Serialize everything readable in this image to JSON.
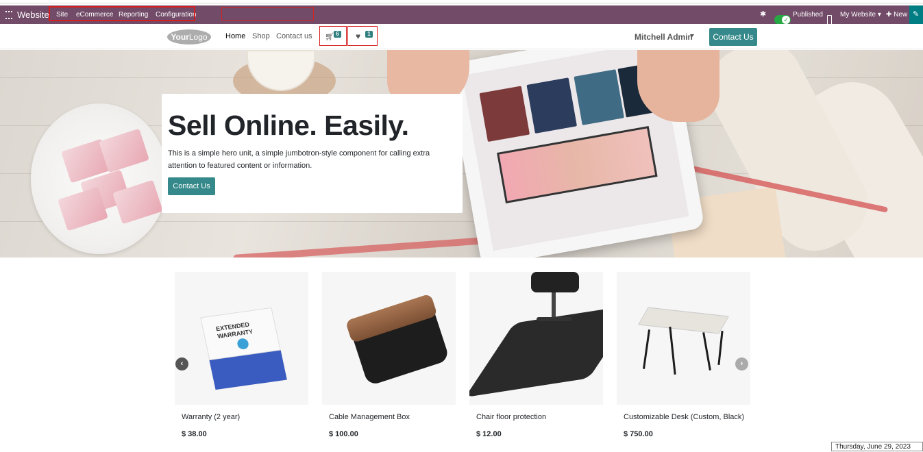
{
  "admin_bar": {
    "app_name": "Website",
    "menu": [
      "Site",
      "eCommerce",
      "Reporting",
      "Configuration"
    ],
    "published_label": "Published",
    "my_website_label": "My Website",
    "new_label": "New"
  },
  "site_header": {
    "logo": {
      "part1": "Your",
      "part2": "Logo"
    },
    "nav": [
      "Home",
      "Shop",
      "Contact us"
    ],
    "cart_count": "6",
    "wishlist_count": "1",
    "user_name": "Mitchell Admin",
    "contact_button": "Contact Us"
  },
  "hero": {
    "title": "Sell Online. Easily.",
    "text": "This is a simple hero unit, a simple jumbotron-style component for calling extra attention to featured content or information.",
    "cta_label": "Contact Us"
  },
  "products": [
    {
      "name": "Warranty (2 year)",
      "price": "$ 38.00",
      "image": "extended-warranty-box"
    },
    {
      "name": "Cable Management Box",
      "price": "$ 100.00",
      "image": "cable-management-box"
    },
    {
      "name": "Chair floor protection",
      "price": "$ 12.00",
      "image": "chair-floor-mat"
    },
    {
      "name": "Customizable Desk (Custom, Black)",
      "price": "$ 750.00",
      "image": "desk"
    }
  ],
  "warranty_box_label": "EXTENDED WARRANTY",
  "date_tooltip": "Thursday, June 29, 2023",
  "colors": {
    "admin_bar": "#714b67",
    "accent": "#35898a",
    "highlight_box": "#d62020"
  }
}
